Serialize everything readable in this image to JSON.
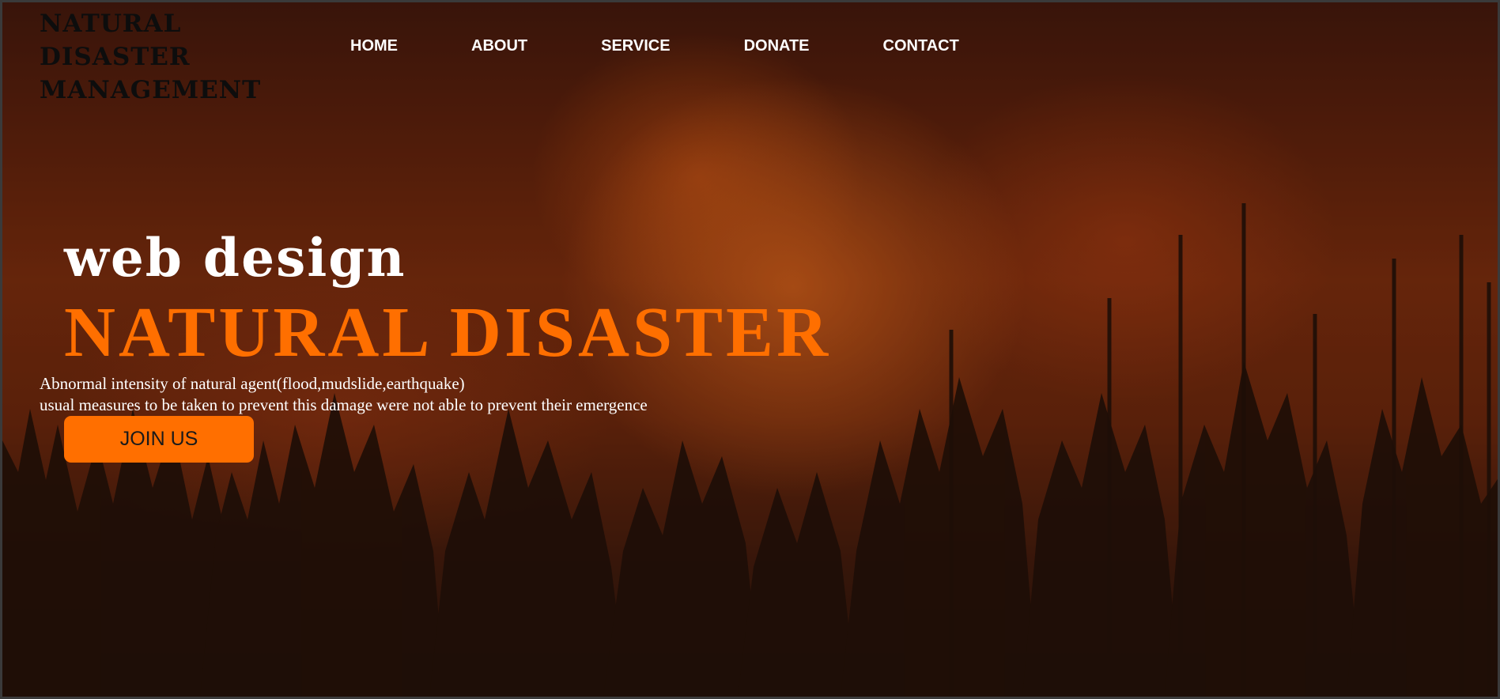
{
  "header": {
    "logo_lines": [
      "NATURAL",
      "DISASTER",
      "MANAGEMENT"
    ]
  },
  "nav": {
    "items": [
      {
        "label": "HOME"
      },
      {
        "label": "ABOUT"
      },
      {
        "label": "SERVICE"
      },
      {
        "label": "DONATE"
      },
      {
        "label": "CONTACT"
      }
    ]
  },
  "hero": {
    "subtitle": "web design",
    "headline": "NATURAL DISASTER",
    "description_lines": [
      "Abnormal intensity of natural agent(flood,mudslide,earthquake)",
      "usual measures to be taken to prevent this damage were not able to prevent their emergence"
    ],
    "cta_label": "JOIN US",
    "background_image": "forest-fire"
  },
  "colors": {
    "accent": "#ff6f00",
    "nav_text": "#ffffff",
    "logo_text": "#0d0d0d"
  }
}
